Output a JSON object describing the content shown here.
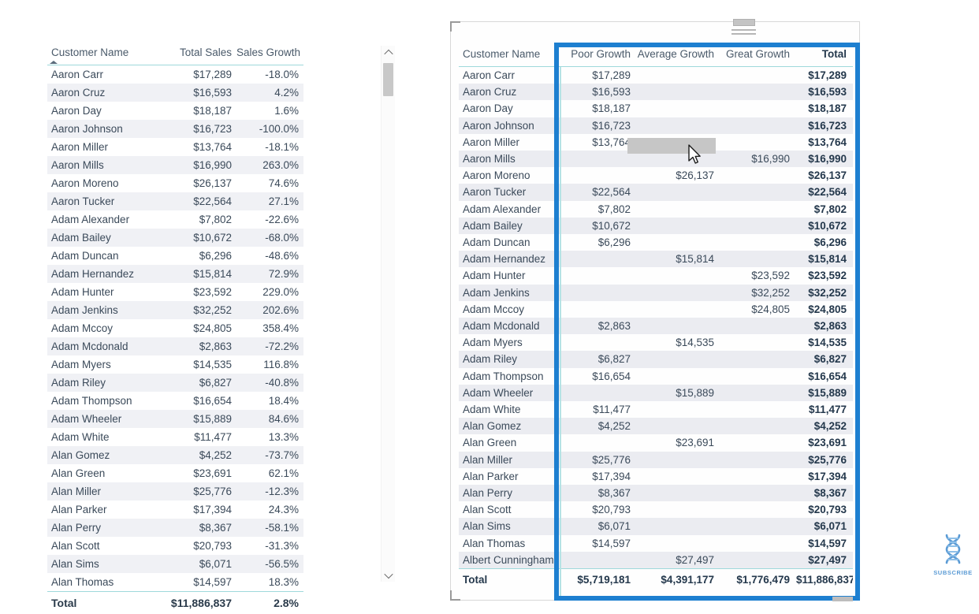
{
  "left_table": {
    "columns": [
      "Customer Name",
      "Total Sales",
      "Sales Growth"
    ],
    "sort_column": "Customer Name",
    "sort_direction": "ascending",
    "rows": [
      {
        "name": "Aaron Carr",
        "total_sales": "$17,289",
        "sales_growth": "-18.0%"
      },
      {
        "name": "Aaron Cruz",
        "total_sales": "$16,593",
        "sales_growth": "4.2%"
      },
      {
        "name": "Aaron Day",
        "total_sales": "$18,187",
        "sales_growth": "1.6%"
      },
      {
        "name": "Aaron Johnson",
        "total_sales": "$16,723",
        "sales_growth": "-100.0%"
      },
      {
        "name": "Aaron Miller",
        "total_sales": "$13,764",
        "sales_growth": "-18.1%"
      },
      {
        "name": "Aaron Mills",
        "total_sales": "$16,990",
        "sales_growth": "263.0%"
      },
      {
        "name": "Aaron Moreno",
        "total_sales": "$26,137",
        "sales_growth": "74.6%"
      },
      {
        "name": "Aaron Tucker",
        "total_sales": "$22,564",
        "sales_growth": "27.1%"
      },
      {
        "name": "Adam Alexander",
        "total_sales": "$7,802",
        "sales_growth": "-22.6%"
      },
      {
        "name": "Adam Bailey",
        "total_sales": "$10,672",
        "sales_growth": "-68.0%"
      },
      {
        "name": "Adam Duncan",
        "total_sales": "$6,296",
        "sales_growth": "-48.6%"
      },
      {
        "name": "Adam Hernandez",
        "total_sales": "$15,814",
        "sales_growth": "72.9%"
      },
      {
        "name": "Adam Hunter",
        "total_sales": "$23,592",
        "sales_growth": "229.0%"
      },
      {
        "name": "Adam Jenkins",
        "total_sales": "$32,252",
        "sales_growth": "202.6%"
      },
      {
        "name": "Adam Mccoy",
        "total_sales": "$24,805",
        "sales_growth": "358.4%"
      },
      {
        "name": "Adam Mcdonald",
        "total_sales": "$2,863",
        "sales_growth": "-72.2%"
      },
      {
        "name": "Adam Myers",
        "total_sales": "$14,535",
        "sales_growth": "116.8%"
      },
      {
        "name": "Adam Riley",
        "total_sales": "$6,827",
        "sales_growth": "-40.8%"
      },
      {
        "name": "Adam Thompson",
        "total_sales": "$16,654",
        "sales_growth": "18.4%"
      },
      {
        "name": "Adam Wheeler",
        "total_sales": "$15,889",
        "sales_growth": "84.6%"
      },
      {
        "name": "Adam White",
        "total_sales": "$11,477",
        "sales_growth": "13.3%"
      },
      {
        "name": "Alan Gomez",
        "total_sales": "$4,252",
        "sales_growth": "-73.7%"
      },
      {
        "name": "Alan Green",
        "total_sales": "$23,691",
        "sales_growth": "62.1%"
      },
      {
        "name": "Alan Miller",
        "total_sales": "$25,776",
        "sales_growth": "-12.3%"
      },
      {
        "name": "Alan Parker",
        "total_sales": "$17,394",
        "sales_growth": "24.3%"
      },
      {
        "name": "Alan Perry",
        "total_sales": "$8,367",
        "sales_growth": "-58.1%"
      },
      {
        "name": "Alan Scott",
        "total_sales": "$20,793",
        "sales_growth": "-31.3%"
      },
      {
        "name": "Alan Sims",
        "total_sales": "$6,071",
        "sales_growth": "-56.5%"
      },
      {
        "name": "Alan Thomas",
        "total_sales": "$14,597",
        "sales_growth": "18.3%"
      }
    ],
    "total": {
      "label": "Total",
      "total_sales": "$11,886,837",
      "sales_growth": "2.8%"
    }
  },
  "right_table": {
    "columns": [
      "Customer Name",
      "Poor Growth",
      "Average Growth",
      "Great Growth",
      "Total"
    ],
    "rows": [
      {
        "name": "Aaron Carr",
        "poor": "$17,289",
        "average": "",
        "great": "",
        "total": "$17,289"
      },
      {
        "name": "Aaron Cruz",
        "poor": "$16,593",
        "average": "",
        "great": "",
        "total": "$16,593"
      },
      {
        "name": "Aaron Day",
        "poor": "$18,187",
        "average": "",
        "great": "",
        "total": "$18,187"
      },
      {
        "name": "Aaron Johnson",
        "poor": "$16,723",
        "average": "",
        "great": "",
        "total": "$16,723"
      },
      {
        "name": "Aaron Miller",
        "poor": "$13,764",
        "average": "",
        "great": "",
        "total": "$13,764"
      },
      {
        "name": "Aaron Mills",
        "poor": "",
        "average": "",
        "great": "$16,990",
        "total": "$16,990"
      },
      {
        "name": "Aaron Moreno",
        "poor": "",
        "average": "$26,137",
        "great": "",
        "total": "$26,137"
      },
      {
        "name": "Aaron Tucker",
        "poor": "$22,564",
        "average": "",
        "great": "",
        "total": "$22,564"
      },
      {
        "name": "Adam Alexander",
        "poor": "$7,802",
        "average": "",
        "great": "",
        "total": "$7,802"
      },
      {
        "name": "Adam Bailey",
        "poor": "$10,672",
        "average": "",
        "great": "",
        "total": "$10,672"
      },
      {
        "name": "Adam Duncan",
        "poor": "$6,296",
        "average": "",
        "great": "",
        "total": "$6,296"
      },
      {
        "name": "Adam Hernandez",
        "poor": "",
        "average": "$15,814",
        "great": "",
        "total": "$15,814"
      },
      {
        "name": "Adam Hunter",
        "poor": "",
        "average": "",
        "great": "$23,592",
        "total": "$23,592"
      },
      {
        "name": "Adam Jenkins",
        "poor": "",
        "average": "",
        "great": "$32,252",
        "total": "$32,252"
      },
      {
        "name": "Adam Mccoy",
        "poor": "",
        "average": "",
        "great": "$24,805",
        "total": "$24,805"
      },
      {
        "name": "Adam Mcdonald",
        "poor": "$2,863",
        "average": "",
        "great": "",
        "total": "$2,863"
      },
      {
        "name": "Adam Myers",
        "poor": "",
        "average": "$14,535",
        "great": "",
        "total": "$14,535"
      },
      {
        "name": "Adam Riley",
        "poor": "$6,827",
        "average": "",
        "great": "",
        "total": "$6,827"
      },
      {
        "name": "Adam Thompson",
        "poor": "$16,654",
        "average": "",
        "great": "",
        "total": "$16,654"
      },
      {
        "name": "Adam Wheeler",
        "poor": "",
        "average": "$15,889",
        "great": "",
        "total": "$15,889"
      },
      {
        "name": "Adam White",
        "poor": "$11,477",
        "average": "",
        "great": "",
        "total": "$11,477"
      },
      {
        "name": "Alan Gomez",
        "poor": "$4,252",
        "average": "",
        "great": "",
        "total": "$4,252"
      },
      {
        "name": "Alan Green",
        "poor": "",
        "average": "$23,691",
        "great": "",
        "total": "$23,691"
      },
      {
        "name": "Alan Miller",
        "poor": "$25,776",
        "average": "",
        "great": "",
        "total": "$25,776"
      },
      {
        "name": "Alan Parker",
        "poor": "$17,394",
        "average": "",
        "great": "",
        "total": "$17,394"
      },
      {
        "name": "Alan Perry",
        "poor": "$8,367",
        "average": "",
        "great": "",
        "total": "$8,367"
      },
      {
        "name": "Alan Scott",
        "poor": "$20,793",
        "average": "",
        "great": "",
        "total": "$20,793"
      },
      {
        "name": "Alan Sims",
        "poor": "$6,071",
        "average": "",
        "great": "",
        "total": "$6,071"
      },
      {
        "name": "Alan Thomas",
        "poor": "$14,597",
        "average": "",
        "great": "",
        "total": "$14,597"
      },
      {
        "name": "Albert Cunningham",
        "poor": "",
        "average": "$27,497",
        "great": "",
        "total": "$27,497"
      }
    ],
    "total": {
      "label": "Total",
      "poor": "$5,719,181",
      "average": "$4,391,177",
      "great": "$1,776,479",
      "total": "$11,886,837"
    },
    "selection_color": "#1d7fd0"
  },
  "watermark": {
    "label": "SUBSCRIBE",
    "icon": "dna-helix-icon",
    "color": "#5b9bd5"
  }
}
